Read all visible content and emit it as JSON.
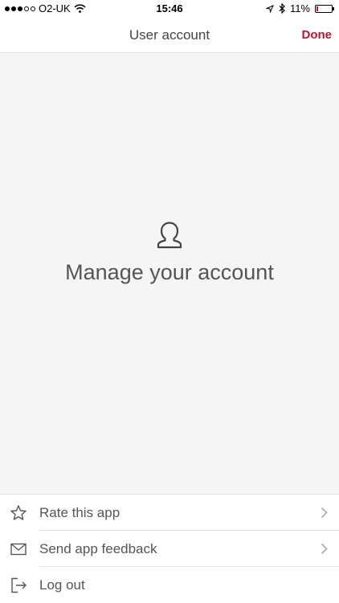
{
  "status_bar": {
    "carrier": "O2-UK",
    "time": "15:46",
    "battery": "11%",
    "battery_level": 0.11,
    "signal_bars_filled": 3,
    "signal_bars_total": 5
  },
  "nav": {
    "title": "User account",
    "done_label": "Done",
    "accent_color": "#c8102e"
  },
  "main": {
    "icon": "user-outline-icon",
    "text": "Manage your account"
  },
  "menu": {
    "items": [
      {
        "label": "Rate this app",
        "icon": "star-icon",
        "has_chevron": true
      },
      {
        "label": "Send app feedback",
        "icon": "envelope-icon",
        "has_chevron": true
      },
      {
        "label": "Log out",
        "icon": "logout-icon",
        "has_chevron": false
      }
    ]
  }
}
